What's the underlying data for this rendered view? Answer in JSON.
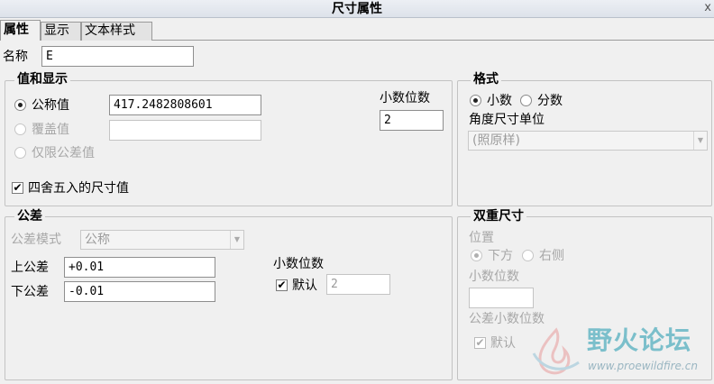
{
  "window": {
    "title": "尺寸属性",
    "close": "x"
  },
  "tabs": [
    "属性",
    "显示",
    "文本样式"
  ],
  "name_field": {
    "label": "名称",
    "value": "E"
  },
  "value_display": {
    "title": "值和显示",
    "nominal_label": "公称值",
    "nominal_value": "417.2482808601",
    "override_label": "覆盖值",
    "override_value": "",
    "tolerance_only_label": "仅限公差值",
    "decimals_label": "小数位数",
    "decimals_value": "2",
    "round_label": "四舍五入的尺寸值",
    "round_checked": true
  },
  "format": {
    "title": "格式",
    "decimal_label": "小数",
    "fraction_label": "分数",
    "angle_units_label": "角度尺寸单位",
    "angle_units_value": "(照原样)"
  },
  "tolerance": {
    "title": "公差",
    "mode_label": "公差模式",
    "mode_value": "公称",
    "upper_label": "上公差",
    "upper_value": "+0.01",
    "lower_label": "下公差",
    "lower_value": "-0.01",
    "decimals_label": "小数位数",
    "default_label": "默认",
    "default_checked": true,
    "decimals_value": "2"
  },
  "dual": {
    "title": "双重尺寸",
    "position_label": "位置",
    "below_label": "下方",
    "right_label": "右侧",
    "decimals_label": "小数位数",
    "decimals_value": "",
    "tol_decimals_label": "公差小数位数",
    "default_label": "默认",
    "default_checked": true
  },
  "watermark": {
    "brand": "野火论坛",
    "url": "www.proewildfire.cn"
  }
}
